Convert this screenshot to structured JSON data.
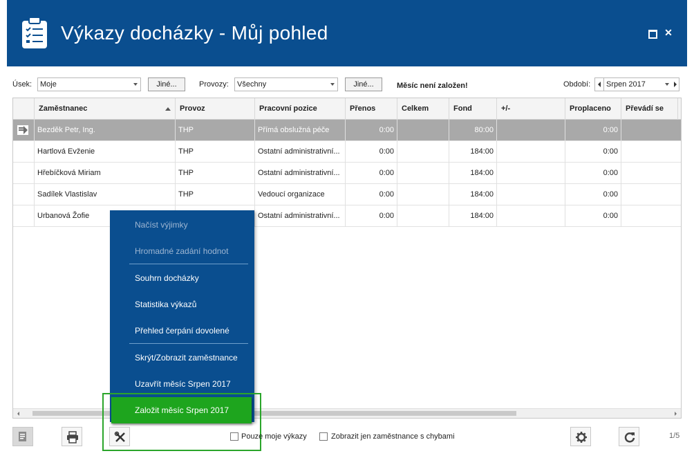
{
  "header": {
    "title": "Výkazy docházky - Můj pohled",
    "icon": "clipboard-checklist-icon",
    "bg": "#0a4e8f"
  },
  "filters": {
    "usek_label": "Úsek:",
    "usek_value": "Moje",
    "usek_other": "Jiné...",
    "provozy_label": "Provozy:",
    "provozy_value": "Všechny",
    "provozy_other": "Jiné...",
    "month_note": "Měsíc není založen!",
    "period_label": "Období:",
    "period_value": "Srpen 2017"
  },
  "grid": {
    "columns": [
      "Zaměstnanec",
      "Provoz",
      "Pracovní pozice",
      "Přenos",
      "Celkem",
      "Fond",
      "+/-",
      "Proplaceno",
      "Převádí se"
    ],
    "rows": [
      {
        "name": "Bezděk Petr, Ing.",
        "provoz": "THP",
        "pozice": "Přímá obslužná péče",
        "prenos": "0:00",
        "celkem": "",
        "fond": "80:00",
        "diff": "",
        "proplaceno": "0:00",
        "prevadi": ""
      },
      {
        "name": "Hartlová Evženie",
        "provoz": "THP",
        "pozice": "Ostatní administrativní...",
        "prenos": "0:00",
        "celkem": "",
        "fond": "184:00",
        "diff": "",
        "proplaceno": "0:00",
        "prevadi": ""
      },
      {
        "name": "Hřebíčková Miriam",
        "provoz": "THP",
        "pozice": "Ostatní administrativní...",
        "prenos": "0:00",
        "celkem": "",
        "fond": "184:00",
        "diff": "",
        "proplaceno": "0:00",
        "prevadi": ""
      },
      {
        "name": "Sadílek Vlastislav",
        "provoz": "THP",
        "pozice": "Vedoucí organizace",
        "prenos": "0:00",
        "celkem": "",
        "fond": "184:00",
        "diff": "",
        "proplaceno": "0:00",
        "prevadi": ""
      },
      {
        "name": "Urbanová Žofie",
        "provoz": "",
        "pozice": "Ostatní administrativní...",
        "prenos": "0:00",
        "celkem": "",
        "fond": "184:00",
        "diff": "",
        "proplaceno": "0:00",
        "prevadi": ""
      }
    ]
  },
  "menu": {
    "items": [
      {
        "label": "Načíst výjimky",
        "disabled": true
      },
      {
        "label": "Hromadné zadání hodnot",
        "disabled": true
      },
      {
        "label": "Souhrn docházky",
        "disabled": false
      },
      {
        "label": "Statistika výkazů",
        "disabled": false
      },
      {
        "label": "Přehled čerpání dovolené",
        "disabled": false
      },
      {
        "label": "Skrýt/Zobrazit zaměstnance",
        "disabled": false
      },
      {
        "label": "Uzavřít měsíc Srpen 2017",
        "disabled": false
      },
      {
        "label": "Založit měsíc Srpen 2017",
        "disabled": false,
        "highlight": "#1ea51e"
      }
    ]
  },
  "footer": {
    "only_my_label": "Pouze moje výkazy",
    "only_errors_label": "Zobrazit jen zaměstnance s chybami",
    "pager": "1/5"
  }
}
